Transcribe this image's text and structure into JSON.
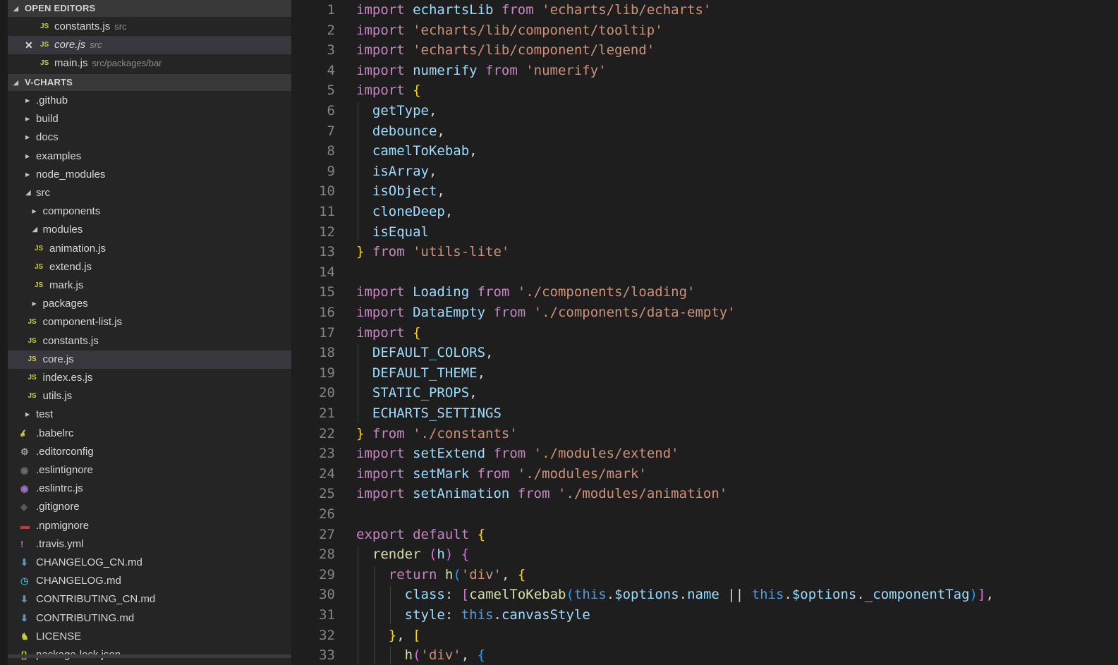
{
  "sidebar": {
    "open_editors_title": "OPEN EDITORS",
    "open_editors": [
      {
        "name": "constants.js",
        "desc": "src",
        "icon": "JS"
      },
      {
        "name": "core.js",
        "desc": "src",
        "icon": "JS",
        "close": "✕"
      },
      {
        "name": "main.js",
        "desc": "src/packages/bar",
        "icon": "JS"
      }
    ],
    "project_title": "V-CHARTS",
    "tree": [
      {
        "name": ".github",
        "kind": "folder",
        "expanded": false
      },
      {
        "name": "build",
        "kind": "folder",
        "expanded": false
      },
      {
        "name": "docs",
        "kind": "folder",
        "expanded": false
      },
      {
        "name": "examples",
        "kind": "folder",
        "expanded": false
      },
      {
        "name": "node_modules",
        "kind": "folder",
        "expanded": false
      },
      {
        "name": "src",
        "kind": "folder",
        "expanded": true
      },
      {
        "name": "components",
        "kind": "folder",
        "expanded": false
      },
      {
        "name": "modules",
        "kind": "folder",
        "expanded": true
      },
      {
        "name": "animation.js",
        "kind": "js",
        "icon": "JS"
      },
      {
        "name": "extend.js",
        "kind": "js",
        "icon": "JS"
      },
      {
        "name": "mark.js",
        "kind": "js",
        "icon": "JS"
      },
      {
        "name": "packages",
        "kind": "folder",
        "expanded": false
      },
      {
        "name": "component-list.js",
        "kind": "js",
        "icon": "JS"
      },
      {
        "name": "constants.js",
        "kind": "js",
        "icon": "JS"
      },
      {
        "name": "core.js",
        "kind": "js",
        "icon": "JS"
      },
      {
        "name": "index.es.js",
        "kind": "js",
        "icon": "JS"
      },
      {
        "name": "utils.js",
        "kind": "js",
        "icon": "JS"
      },
      {
        "name": "test",
        "kind": "folder",
        "expanded": false
      },
      {
        "name": ".babelrc",
        "kind": "file",
        "icon_name": "babel-icon",
        "icon_color": "#cbcb41"
      },
      {
        "name": ".editorconfig",
        "kind": "file",
        "icon_name": "gear-icon",
        "icon_color": "#9e9e9e"
      },
      {
        "name": ".eslintignore",
        "kind": "file",
        "icon_name": "eslint-icon",
        "icon_color": "#6b6b6b"
      },
      {
        "name": ".eslintrc.js",
        "kind": "file",
        "icon_name": "eslint-icon",
        "icon_color": "#a074c4"
      },
      {
        "name": ".gitignore",
        "kind": "file",
        "icon_name": "git-icon",
        "icon_color": "#5a5a5a"
      },
      {
        "name": ".npmignore",
        "kind": "file",
        "icon_name": "npm-icon",
        "icon_color": "#cb3837"
      },
      {
        "name": ".travis.yml",
        "kind": "file",
        "icon_name": "exclamation-icon",
        "icon_color": "#a074c4"
      },
      {
        "name": "CHANGELOG_CN.md",
        "kind": "file",
        "icon_name": "markdown-icon",
        "icon_color": "#519aba"
      },
      {
        "name": "CHANGELOG.md",
        "kind": "file",
        "icon_name": "clock-icon",
        "icon_color": "#519aba"
      },
      {
        "name": "CONTRIBUTING_CN.md",
        "kind": "file",
        "icon_name": "markdown-icon",
        "icon_color": "#519aba"
      },
      {
        "name": "CONTRIBUTING.md",
        "kind": "file",
        "icon_name": "markdown-icon",
        "icon_color": "#519aba"
      },
      {
        "name": "LICENSE",
        "kind": "file",
        "icon_name": "license-icon",
        "icon_color": "#cbcb41"
      },
      {
        "name": "package-lock.json",
        "kind": "file",
        "icon_name": "json-icon",
        "icon_color": "#cbcb41"
      }
    ]
  },
  "editor": {
    "lines": [
      [
        [
          "k",
          "import "
        ],
        [
          "v",
          "echartsLib "
        ],
        [
          "k",
          "from "
        ],
        [
          "s",
          "'echarts/lib/echarts'"
        ]
      ],
      [
        [
          "k",
          "import "
        ],
        [
          "s",
          "'echarts/lib/component/tooltip'"
        ]
      ],
      [
        [
          "k",
          "import "
        ],
        [
          "s",
          "'echarts/lib/component/legend'"
        ]
      ],
      [
        [
          "k",
          "import "
        ],
        [
          "v",
          "numerify "
        ],
        [
          "k",
          "from "
        ],
        [
          "s",
          "'numerify'"
        ]
      ],
      [
        [
          "k",
          "import "
        ],
        [
          "b1",
          "{"
        ]
      ],
      [
        [
          "p",
          "  "
        ],
        [
          "v",
          "getType"
        ],
        [
          "p",
          ","
        ]
      ],
      [
        [
          "p",
          "  "
        ],
        [
          "v",
          "debounce"
        ],
        [
          "p",
          ","
        ]
      ],
      [
        [
          "p",
          "  "
        ],
        [
          "v",
          "camelToKebab"
        ],
        [
          "p",
          ","
        ]
      ],
      [
        [
          "p",
          "  "
        ],
        [
          "v",
          "isArray"
        ],
        [
          "p",
          ","
        ]
      ],
      [
        [
          "p",
          "  "
        ],
        [
          "v",
          "isObject"
        ],
        [
          "p",
          ","
        ]
      ],
      [
        [
          "p",
          "  "
        ],
        [
          "v",
          "cloneDeep"
        ],
        [
          "p",
          ","
        ]
      ],
      [
        [
          "p",
          "  "
        ],
        [
          "v",
          "isEqual"
        ]
      ],
      [
        [
          "b1",
          "} "
        ],
        [
          "k",
          "from "
        ],
        [
          "s",
          "'utils-lite'"
        ]
      ],
      [],
      [
        [
          "k",
          "import "
        ],
        [
          "v",
          "Loading "
        ],
        [
          "k",
          "from "
        ],
        [
          "s",
          "'./components/loading'"
        ]
      ],
      [
        [
          "k",
          "import "
        ],
        [
          "v",
          "DataEmpty "
        ],
        [
          "k",
          "from "
        ],
        [
          "s",
          "'./components/data-empty'"
        ]
      ],
      [
        [
          "k",
          "import "
        ],
        [
          "b1",
          "{"
        ]
      ],
      [
        [
          "p",
          "  "
        ],
        [
          "v",
          "DEFAULT_COLORS"
        ],
        [
          "p",
          ","
        ]
      ],
      [
        [
          "p",
          "  "
        ],
        [
          "v",
          "DEFAULT_THEME"
        ],
        [
          "p",
          ","
        ]
      ],
      [
        [
          "p",
          "  "
        ],
        [
          "v",
          "STATIC_PROPS"
        ],
        [
          "p",
          ","
        ]
      ],
      [
        [
          "p",
          "  "
        ],
        [
          "v",
          "ECHARTS_SETTINGS"
        ]
      ],
      [
        [
          "b1",
          "} "
        ],
        [
          "k",
          "from "
        ],
        [
          "s",
          "'./constants'"
        ]
      ],
      [
        [
          "k",
          "import "
        ],
        [
          "v",
          "setExtend "
        ],
        [
          "k",
          "from "
        ],
        [
          "s",
          "'./modules/extend'"
        ]
      ],
      [
        [
          "k",
          "import "
        ],
        [
          "v",
          "setMark "
        ],
        [
          "k",
          "from "
        ],
        [
          "s",
          "'./modules/mark'"
        ]
      ],
      [
        [
          "k",
          "import "
        ],
        [
          "v",
          "setAnimation "
        ],
        [
          "k",
          "from "
        ],
        [
          "s",
          "'./modules/animation'"
        ]
      ],
      [],
      [
        [
          "k",
          "export default "
        ],
        [
          "b1",
          "{"
        ]
      ],
      [
        [
          "p",
          "  "
        ],
        [
          "f",
          "render "
        ],
        [
          "b2",
          "("
        ],
        [
          "v",
          "h"
        ],
        [
          "b2",
          ") "
        ],
        [
          "b2",
          "{"
        ]
      ],
      [
        [
          "p",
          "    "
        ],
        [
          "k",
          "return "
        ],
        [
          "f",
          "h"
        ],
        [
          "b3",
          "("
        ],
        [
          "s",
          "'div'"
        ],
        [
          "p",
          ", "
        ],
        [
          "b1",
          "{"
        ]
      ],
      [
        [
          "p",
          "      "
        ],
        [
          "v",
          "class"
        ],
        [
          "p",
          ": "
        ],
        [
          "b2",
          "["
        ],
        [
          "f",
          "camelToKebab"
        ],
        [
          "b3",
          "("
        ],
        [
          "th",
          "this"
        ],
        [
          "p",
          "."
        ],
        [
          "v",
          "$options"
        ],
        [
          "p",
          "."
        ],
        [
          "v",
          "name "
        ],
        [
          "p",
          "|| "
        ],
        [
          "th",
          "this"
        ],
        [
          "p",
          "."
        ],
        [
          "v",
          "$options"
        ],
        [
          "p",
          "."
        ],
        [
          "v",
          "_componentTag"
        ],
        [
          "b3",
          ")"
        ],
        [
          "b2",
          "]"
        ],
        [
          "p",
          ","
        ]
      ],
      [
        [
          "p",
          "      "
        ],
        [
          "v",
          "style"
        ],
        [
          "p",
          ": "
        ],
        [
          "th",
          "this"
        ],
        [
          "p",
          "."
        ],
        [
          "v",
          "canvasStyle"
        ]
      ],
      [
        [
          "p",
          "    "
        ],
        [
          "b1",
          "}"
        ],
        [
          "p",
          ", "
        ],
        [
          "b1",
          "["
        ]
      ],
      [
        [
          "p",
          "      "
        ],
        [
          "f",
          "h"
        ],
        [
          "b2",
          "("
        ],
        [
          "s",
          "'div'"
        ],
        [
          "p",
          ", "
        ],
        [
          "b3",
          "{"
        ]
      ]
    ]
  }
}
